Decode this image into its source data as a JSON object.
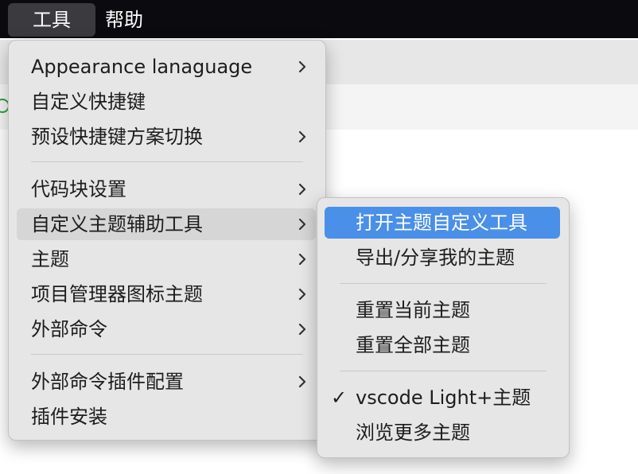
{
  "menubar": {
    "items": [
      {
        "label": "工具"
      },
      {
        "label": "帮助"
      }
    ]
  },
  "tools_menu": {
    "items": [
      {
        "label": "Appearance lanaguage",
        "has_submenu": true
      },
      {
        "label": "自定义快捷键",
        "has_submenu": false
      },
      {
        "label": "预设快捷键方案切换",
        "has_submenu": true
      },
      {
        "label": "代码块设置",
        "has_submenu": true
      },
      {
        "label": "自定义主题辅助工具",
        "has_submenu": true,
        "highlighted": true
      },
      {
        "label": "主题",
        "has_submenu": true
      },
      {
        "label": "项目管理器图标主题",
        "has_submenu": true
      },
      {
        "label": "外部命令",
        "has_submenu": true
      },
      {
        "label": "外部命令插件配置",
        "has_submenu": true
      },
      {
        "label": "插件安装",
        "has_submenu": false
      }
    ]
  },
  "theme_tools_submenu": {
    "items": [
      {
        "label": "打开主题自定义工具",
        "selected": true
      },
      {
        "label": "导出/分享我的主题"
      },
      {
        "label": "重置当前主题"
      },
      {
        "label": "重置全部主题"
      },
      {
        "label": "vscode Light+主题",
        "checked": true,
        "check_mark": "✓"
      },
      {
        "label": "浏览更多主题"
      }
    ]
  },
  "colors": {
    "menubar_bg": "#0b0b0f",
    "menu_bg": "#e6e6e6",
    "selection": "#4a8fe8",
    "hover": "#d6d6d6"
  }
}
